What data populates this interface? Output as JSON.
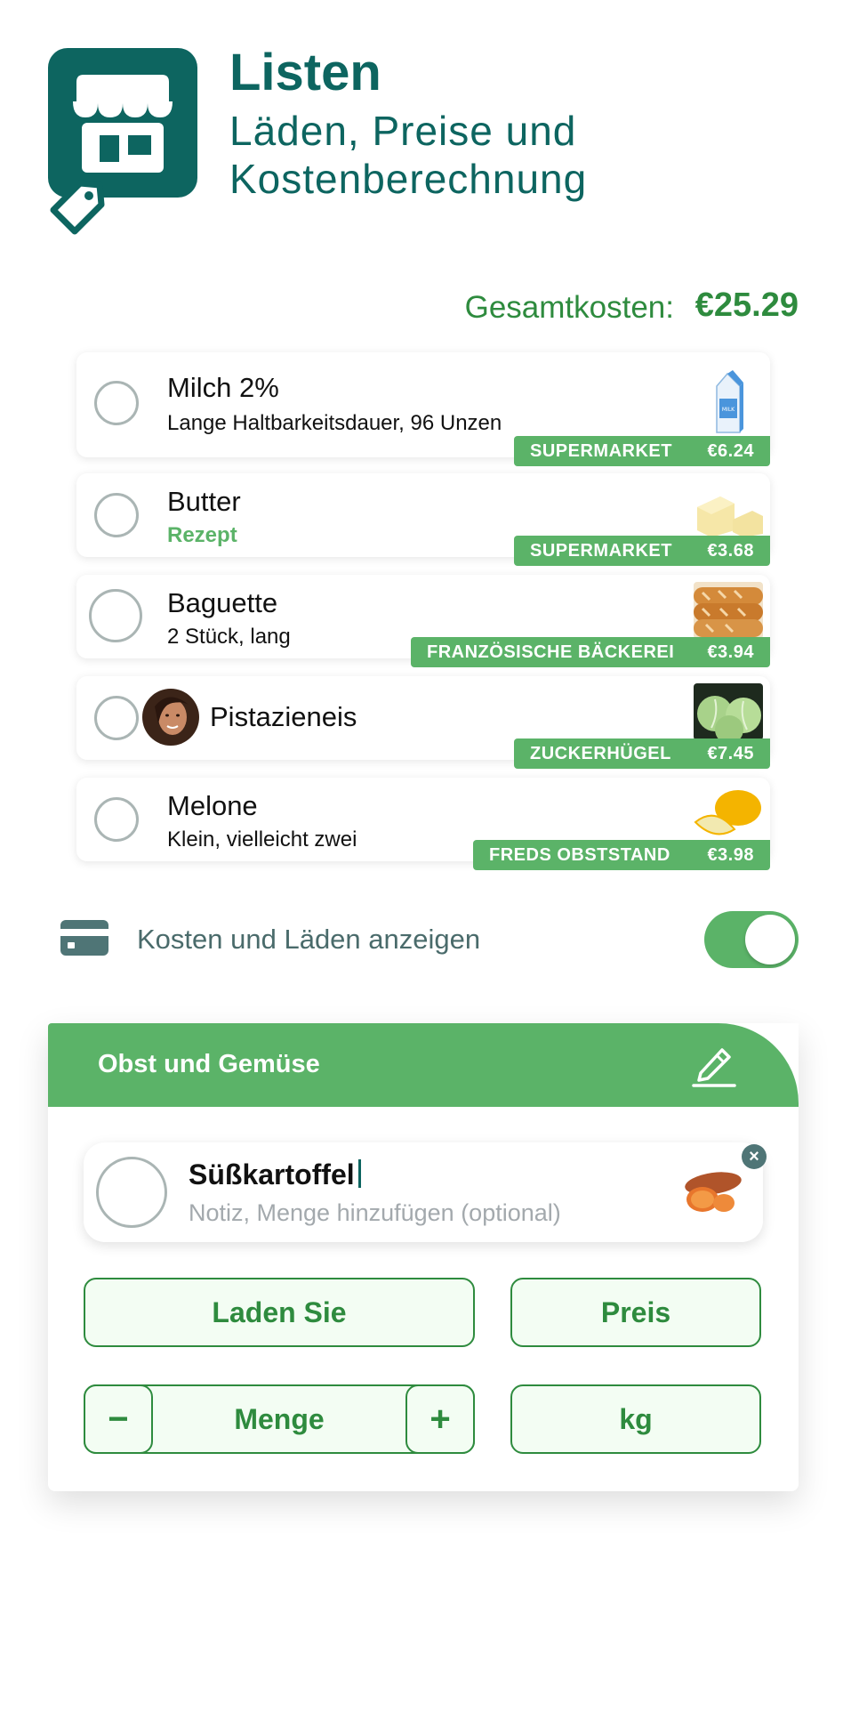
{
  "header": {
    "title": "Listen",
    "subtitle_line1": "Läden, Preise und",
    "subtitle_line2": "Kostenberechnung"
  },
  "total": {
    "label": "Gesamtkosten:",
    "value": "€25.29"
  },
  "items": [
    {
      "name": "Milch 2%",
      "note": "Lange Haltbarkeitsdauer, 96 Unzen",
      "store": "SUPERMARKET",
      "price": "€6.24",
      "thumb": "milk-carton-icon"
    },
    {
      "name": "Butter",
      "note": "Rezept",
      "store": "SUPERMARKET",
      "price": "€3.68",
      "thumb": "butter-icon"
    },
    {
      "name": "Baguette",
      "note": "2 Stück, lang",
      "store": "FRANZÖSISCHE BÄCKEREI",
      "price": "€3.94",
      "thumb": "baguette-icon"
    },
    {
      "name": "Pistazieneis",
      "note": "",
      "store": "ZUCKERHÜGEL",
      "price": "€7.45",
      "thumb": "cabbage-icon"
    },
    {
      "name": "Melone",
      "note": "Klein, vielleicht zwei",
      "store": "FREDS OBSTSTAND",
      "price": "€3.98",
      "thumb": "melon-icon"
    }
  ],
  "toggle": {
    "label": "Kosten und Läden anzeigen",
    "on": true
  },
  "category": {
    "title": "Obst und Gemüse",
    "edit_item": {
      "name": "Süßkartoffel",
      "placeholder": "Notiz, Menge hinzufügen (optional)"
    },
    "buttons": {
      "store": "Laden Sie",
      "price": "Preis",
      "quantity": "Menge",
      "unit": "kg",
      "minus": "−",
      "plus": "+"
    }
  },
  "colors": {
    "brand": "#0d6560",
    "accent_green": "#5bb368",
    "text_green": "#2e8b3e"
  }
}
